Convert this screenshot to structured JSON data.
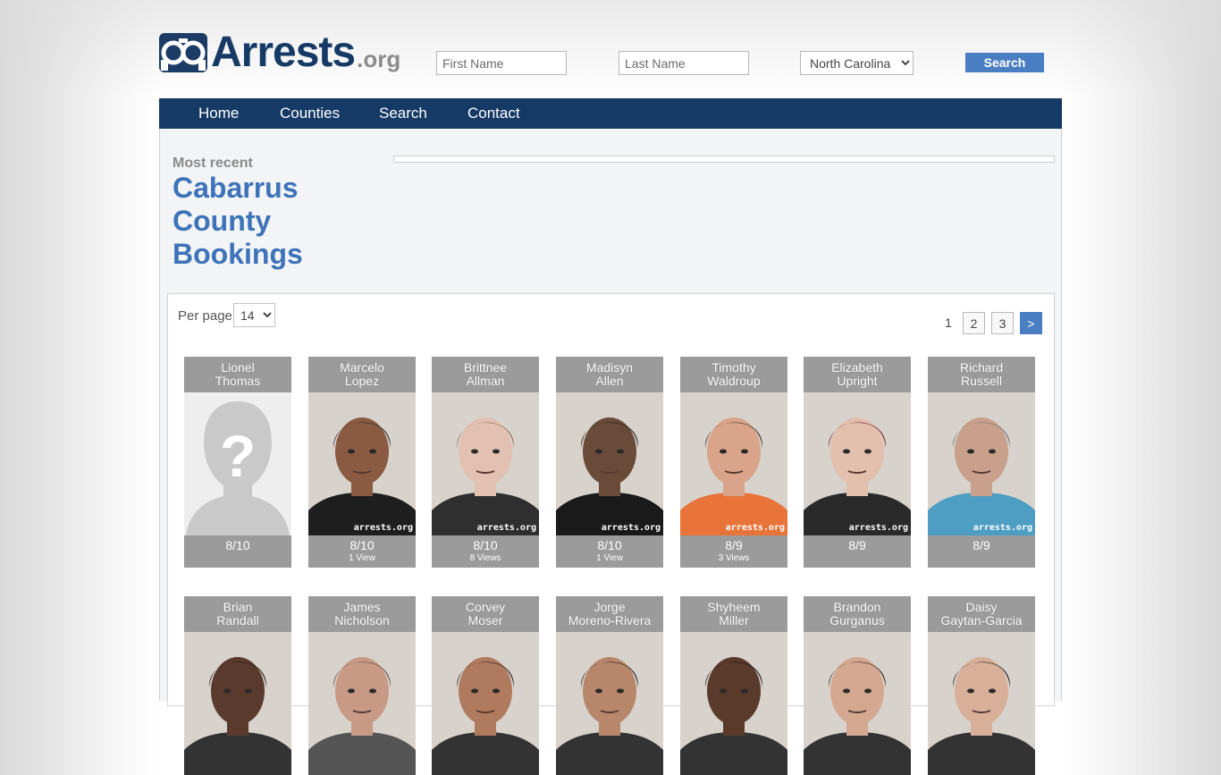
{
  "site": {
    "logo_text": "Arrests",
    "logo_suffix": ".org"
  },
  "search": {
    "first_placeholder": "First Name",
    "last_placeholder": "Last Name",
    "state_selected": "North Carolina",
    "button_label": "Search"
  },
  "nav": {
    "items": [
      "Home",
      "Counties",
      "Search",
      "Contact"
    ]
  },
  "heading": {
    "kicker": "Most recent",
    "title": "Cabarrus County Bookings"
  },
  "listing": {
    "per_page_label": "Per page",
    "per_page_value": "14",
    "pagination": {
      "current": "1",
      "pages": [
        "2",
        "3"
      ],
      "next": ">"
    }
  },
  "bookings": [
    {
      "first": "Lionel",
      "last": "Thomas",
      "date": "8/10",
      "views": "",
      "placeholder": true,
      "shirt": "#cfcfcf",
      "skin": "#cfcfcf",
      "hair": "#cfcfcf"
    },
    {
      "first": "Marcelo",
      "last": "Lopez",
      "date": "8/10",
      "views": "1 View",
      "placeholder": false,
      "shirt": "#1e1e1e",
      "skin": "#8a5a42",
      "hair": "#2a2a2a"
    },
    {
      "first": "Brittnee",
      "last": "Allman",
      "date": "8/10",
      "views": "8 Views",
      "placeholder": false,
      "shirt": "#2f2f2f",
      "skin": "#e2c1b2",
      "hair": "#8e6f56"
    },
    {
      "first": "Madisyn",
      "last": "Allen",
      "date": "8/10",
      "views": "1 View",
      "placeholder": false,
      "shirt": "#1a1a1a",
      "skin": "#6a4a38",
      "hair": "#141414"
    },
    {
      "first": "Timothy",
      "last": "Waldroup",
      "date": "8/9",
      "views": "3 Views",
      "placeholder": false,
      "shirt": "#e8743a",
      "skin": "#d9a48a",
      "hair": "#3a2a22"
    },
    {
      "first": "Elizabeth",
      "last": "Upright",
      "date": "8/9",
      "views": "",
      "placeholder": false,
      "shirt": "#2a2a2a",
      "skin": "#e3bfae",
      "hair": "#6e1f2a"
    },
    {
      "first": "Richard",
      "last": "Russell",
      "date": "8/9",
      "views": "",
      "placeholder": false,
      "shirt": "#4d9ec2",
      "skin": "#c8a08c",
      "hair": "#6e6e6e"
    },
    {
      "first": "Brian",
      "last": "Randall",
      "date": "",
      "views": "",
      "placeholder": false,
      "shirt": "#333333",
      "skin": "#5a3a2c",
      "hair": "#2a1a14"
    },
    {
      "first": "James",
      "last": "Nicholson",
      "date": "",
      "views": "",
      "placeholder": false,
      "shirt": "#555555",
      "skin": "#c89a86",
      "hair": "#5a4a3e"
    },
    {
      "first": "Corvey",
      "last": "Moser",
      "date": "",
      "views": "",
      "placeholder": false,
      "shirt": "#333333",
      "skin": "#b07a5e",
      "hair": "#1a1a1a"
    },
    {
      "first": "Jorge",
      "last": "Moreno-Rivera",
      "date": "",
      "views": "",
      "placeholder": false,
      "shirt": "#333333",
      "skin": "#b8866a",
      "hair": "#1a1a1a"
    },
    {
      "first": "Shyheem",
      "last": "Miller",
      "date": "",
      "views": "",
      "placeholder": false,
      "shirt": "#333333",
      "skin": "#5a3a2a",
      "hair": "#141414"
    },
    {
      "first": "Brandon",
      "last": "Gurganus",
      "date": "",
      "views": "",
      "placeholder": false,
      "shirt": "#333333",
      "skin": "#d4a890",
      "hair": "#2a1e16"
    },
    {
      "first": "Daisy",
      "last": "Gaytan-Garcia",
      "date": "",
      "views": "",
      "placeholder": false,
      "shirt": "#333333",
      "skin": "#d8b09a",
      "hair": "#1a1412"
    }
  ],
  "watermark": "arrests.org"
}
